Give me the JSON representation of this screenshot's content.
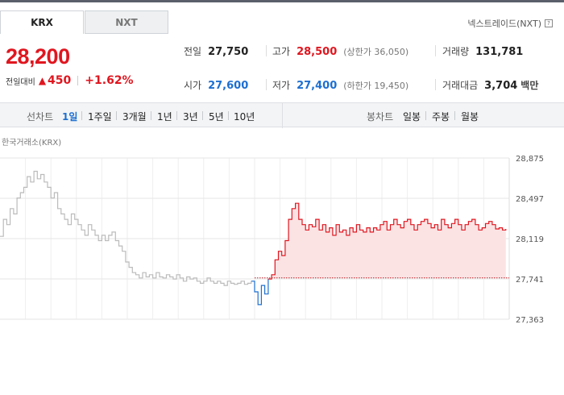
{
  "tabs": [
    {
      "label": "KRX",
      "active": true
    },
    {
      "label": "NXT",
      "active": false
    }
  ],
  "nxt_trade_label": "넥스트레이드(NXT)",
  "price": {
    "current": "28,200",
    "change_label": "전일대비",
    "change_value": "450",
    "change_pct": "+1.62%",
    "direction": "up"
  },
  "metrics": {
    "prev_close": {
      "label": "전일",
      "value": "27,750"
    },
    "open": {
      "label": "시가",
      "value": "27,600"
    },
    "high": {
      "label": "고가",
      "value": "28,500",
      "sub_label": "(상한가 36,050)"
    },
    "low": {
      "label": "저가",
      "value": "27,400",
      "sub_label": "(하한가 19,450)"
    },
    "volume": {
      "label": "거래량",
      "value": "131,781"
    },
    "amount": {
      "label": "거래대금",
      "value": "3,704",
      "unit": "백만"
    }
  },
  "toolbar": {
    "line_chart_label": "선차트",
    "periods": [
      "1일",
      "1주일",
      "3개월",
      "1년",
      "3년",
      "5년",
      "10년"
    ],
    "active_period": "1일",
    "candle_chart_label": "봉차트",
    "candle_periods": [
      "일봉",
      "주봉",
      "월봉"
    ]
  },
  "chart_title": "한국거래소(KRX)",
  "colors": {
    "up": "#e0161f",
    "down": "#1c6fd1",
    "neutral": "#bbbbbb",
    "fill": "#fbe3e4"
  },
  "chart_data": {
    "type": "line",
    "title": "",
    "xlabel": "",
    "ylabel": "",
    "y_ticks": [
      28875,
      28497,
      28119,
      27741,
      27363
    ],
    "y_tick_labels": [
      "28,875",
      "28,497",
      "28,119",
      "27,741",
      "27,363"
    ],
    "ylim": [
      27363,
      28875
    ],
    "reference_line": 27750,
    "series": [
      {
        "segment": "pre-market",
        "values": [
          28140,
          28300,
          28250,
          28400,
          28350,
          28500,
          28550,
          28600,
          28700,
          28650,
          28750,
          28680,
          28720,
          28650,
          28600,
          28500,
          28550,
          28400,
          28350,
          28300,
          28250,
          28350,
          28300,
          28250,
          28200,
          28150,
          28250,
          28200,
          28150,
          28100,
          28150,
          28100,
          28150,
          28180,
          28100,
          28050,
          28000,
          27900,
          27850,
          27800,
          27780,
          27750,
          27800,
          27760,
          27780,
          27750,
          27800,
          27760,
          27750,
          27780,
          27760,
          27740,
          27780,
          27750,
          27720,
          27760,
          27740,
          27750,
          27720,
          27700,
          27720,
          27750,
          27720,
          27700,
          27720,
          27700,
          27680,
          27720,
          27700,
          27690,
          27700,
          27720,
          27690,
          27700,
          27720
        ]
      },
      {
        "segment": "below-prev",
        "values": [
          27620,
          27500,
          27680,
          27600,
          27740
        ]
      },
      {
        "segment": "above-prev",
        "values": [
          27780,
          27920,
          28000,
          27960,
          28100,
          28300,
          28400,
          28450,
          28300,
          28250,
          28200,
          28250,
          28230,
          28300,
          28200,
          28250,
          28180,
          28220,
          28150,
          28250,
          28180,
          28200,
          28150,
          28220,
          28180,
          28250,
          28200,
          28180,
          28220,
          28180,
          28220,
          28200,
          28250,
          28280,
          28200,
          28250,
          28300,
          28250,
          28220,
          28280,
          28300,
          28250,
          28200,
          28250,
          28280,
          28300,
          28260,
          28220,
          28250,
          28200,
          28300,
          28250,
          28220,
          28260,
          28300,
          28250,
          28200,
          28250,
          28280,
          28300,
          28250,
          28200,
          28220,
          28260,
          28280,
          28250,
          28210,
          28220,
          28200,
          28210
        ]
      }
    ]
  }
}
